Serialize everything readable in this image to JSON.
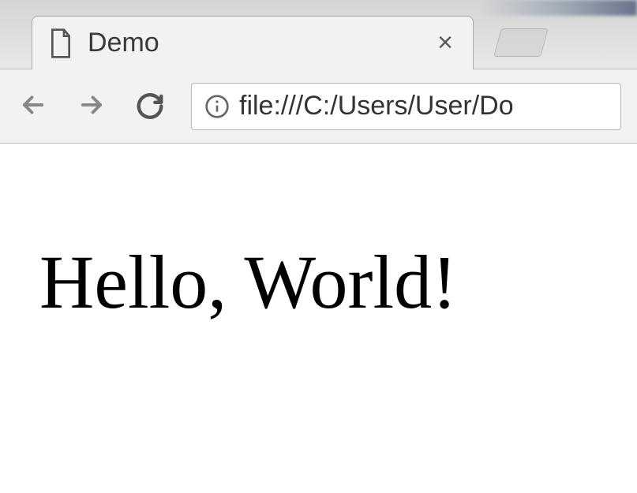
{
  "tab": {
    "title": "Demo",
    "icon": "file-icon"
  },
  "address": {
    "url": "file:///C:/Users/User/Do"
  },
  "page": {
    "heading": "Hello, World!"
  }
}
